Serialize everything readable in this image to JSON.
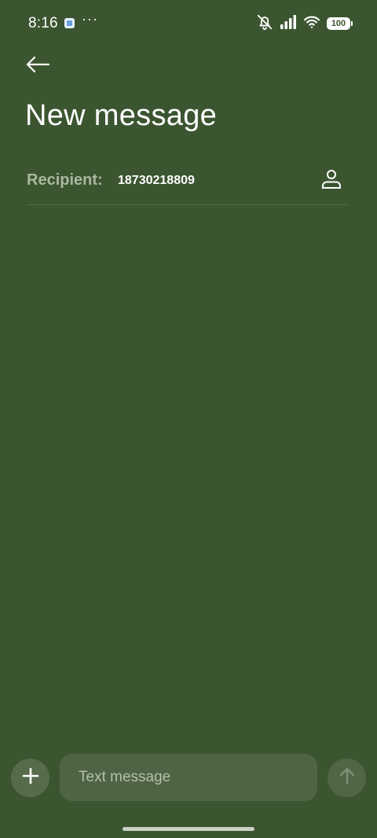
{
  "status_bar": {
    "time": "8:16",
    "more": "···",
    "battery": "100",
    "icons": [
      "app-notification-icon",
      "bell-off-icon",
      "signal-icon",
      "wifi-icon",
      "battery-icon"
    ]
  },
  "header": {
    "title": "New message",
    "back_icon": "arrow-left-icon"
  },
  "recipient": {
    "label": "Recipient:",
    "value": "18730218809",
    "contacts_icon": "person-icon"
  },
  "composer": {
    "placeholder": "Text message",
    "attach_icon": "plus-icon",
    "send_icon": "arrow-up-icon"
  },
  "colors": {
    "background": "#3b5530",
    "field": "#4e6444",
    "label": "#a9b8a0"
  }
}
